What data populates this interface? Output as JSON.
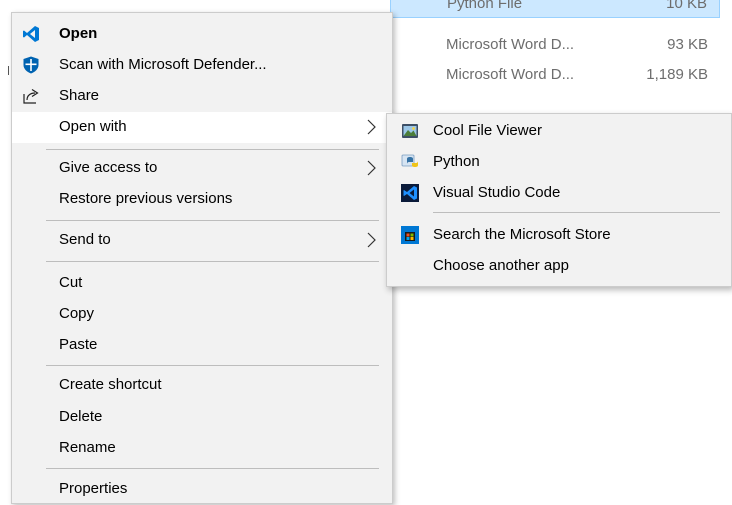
{
  "background_files": [
    {
      "type": "Python File",
      "size": "10 KB"
    },
    {
      "type": "Microsoft Word D...",
      "size": "93 KB"
    },
    {
      "type": "Microsoft Word D...",
      "size": "1,189 KB"
    }
  ],
  "context_menu": {
    "items": [
      {
        "label": "Open",
        "icon": "vscode-icon",
        "bold": true
      },
      {
        "label": "Scan with Microsoft Defender...",
        "icon": "defender-shield-icon"
      },
      {
        "label": "Share",
        "icon": "share-icon"
      },
      {
        "label": "Open with",
        "submenu": true,
        "highlighted": true
      },
      {
        "label": "Give access to",
        "submenu": true
      },
      {
        "label": "Restore previous versions"
      },
      {
        "label": "Send to",
        "submenu": true
      },
      {
        "label": "Cut"
      },
      {
        "label": "Copy"
      },
      {
        "label": "Paste"
      },
      {
        "label": "Create shortcut"
      },
      {
        "label": "Delete"
      },
      {
        "label": "Rename"
      },
      {
        "label": "Properties"
      }
    ]
  },
  "open_with_submenu": {
    "items": [
      {
        "label": "Cool File Viewer",
        "icon": "cool-file-viewer-icon"
      },
      {
        "label": "Python",
        "icon": "python-icon"
      },
      {
        "label": "Visual Studio Code",
        "icon": "vscode-icon"
      },
      {
        "label": "Search the Microsoft Store",
        "icon": "microsoft-store-icon"
      },
      {
        "label": "Choose another app"
      }
    ]
  },
  "colors": {
    "menu_background": "#f2f2f2",
    "menu_hover": "#ffffff",
    "selection_background": "#cce8ff",
    "vscode_blue": "#0078d4",
    "defender_blue": "#0063b1"
  }
}
